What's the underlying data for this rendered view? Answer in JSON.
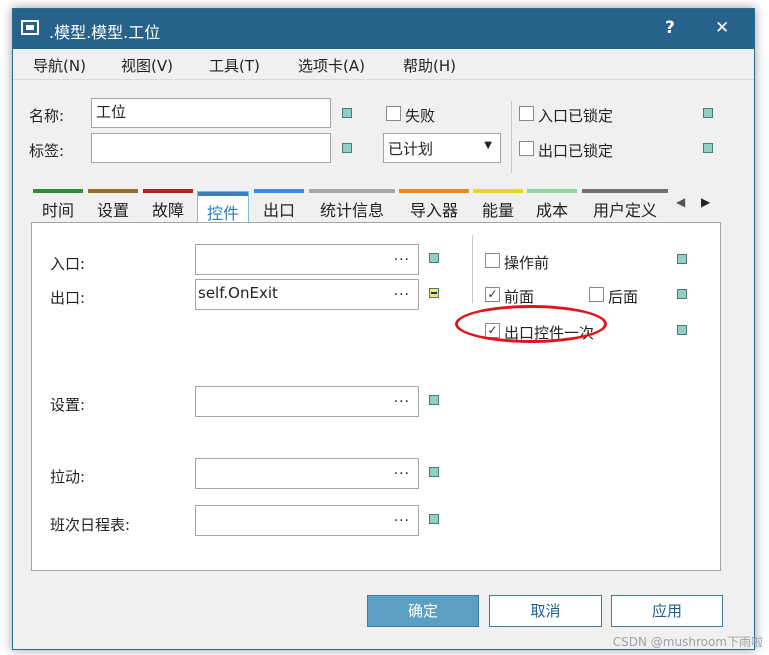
{
  "window": {
    "title": ".模型.模型.工位",
    "help": "?",
    "close": "✕"
  },
  "menu": [
    "导航(N)",
    "视图(V)",
    "工具(T)",
    "选项卡(A)",
    "帮助(H)"
  ],
  "header": {
    "name_label": "名称:",
    "name_value": "工位",
    "tag_label": "标签:",
    "tag_value": "",
    "failure_label": "失败",
    "state_value": "已计划",
    "entrance_locked_label": "入口已锁定",
    "exit_locked_label": "出口已锁定"
  },
  "tabs": [
    {
      "label": "时间",
      "color": "#2e8b3a"
    },
    {
      "label": "设置",
      "color": "#9b6b2c"
    },
    {
      "label": "故障",
      "color": "#a32a2a"
    },
    {
      "label": "控件",
      "color": "#3a7fc0",
      "active": true
    },
    {
      "label": "出口",
      "color": "#3a8fd8"
    },
    {
      "label": "统计信息",
      "color": "#a8a8a8"
    },
    {
      "label": "导入器",
      "color": "#e08a2a"
    },
    {
      "label": "能量",
      "color": "#e8d42a"
    },
    {
      "label": "成本",
      "color": "#8ed8a0"
    },
    {
      "label": "用户定义",
      "color": "#707070"
    }
  ],
  "controls": {
    "entrance_label": "入口:",
    "entrance_value": "",
    "exit_label": "出口:",
    "exit_value": "self.OnExit",
    "setup_label": "设置:",
    "setup_value": "",
    "pull_label": "拉动:",
    "pull_value": "",
    "shift_label": "班次日程表:",
    "shift_value": "",
    "dots": "...",
    "before_actions_label": "操作前",
    "front_label": "前面",
    "rear_label": "后面",
    "exit_once_label": "出口控件一次",
    "check_mark": "✓"
  },
  "buttons": {
    "ok": "确定",
    "cancel": "取消",
    "apply": "应用"
  },
  "watermark": "CSDN @mushroom下雨啦"
}
